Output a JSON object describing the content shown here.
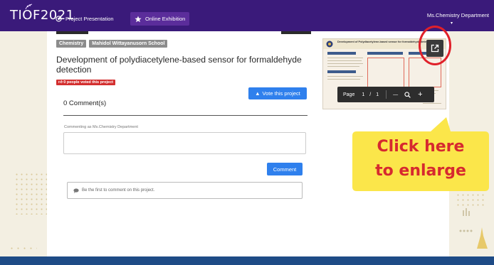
{
  "nav": {
    "logo": "TIOF2021",
    "project_presentation": "Project Presentation",
    "online_exhibition": "Online Exhibition",
    "user": "Ms.Chemistry Department",
    "user_caret": "▾"
  },
  "project": {
    "tags": [
      "Chemistry",
      "Mahidol Wittayanusorn School"
    ],
    "title": "Development of polydiacetylene-based sensor for formaldehyde detection",
    "voted_count": "0 people voted this project",
    "vote_button": "Vote this project"
  },
  "comments": {
    "title": "0 Comment(s)",
    "commenting_as": "Commenting as Ms.Chemistry Department",
    "input_value": "",
    "submit": "Comment",
    "empty_message": "Be the first to comment on this project."
  },
  "poster": {
    "title": "Development of Polydiacetylene-based sensor for formaldehyde detection",
    "page_label": "Page",
    "current_page": "1",
    "page_sep": "/",
    "total_pages": "1",
    "zoom_out": "—",
    "zoom_icon": "zoom-in-icon",
    "zoom_in": "+"
  },
  "annotation": {
    "line1": "Click here",
    "line2": "to enlarge"
  },
  "colors": {
    "nav_bg": "#3a1a7a",
    "accent": "#2f80ed",
    "vote_badge": "#d32f2f",
    "callout": "#fbe64a",
    "callout_text": "#d6292f",
    "footer": "#1e4b86"
  }
}
